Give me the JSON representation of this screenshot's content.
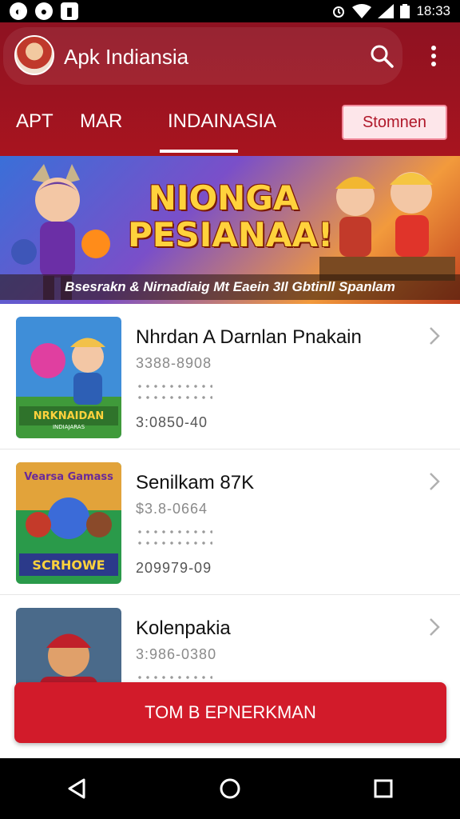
{
  "status_bar": {
    "time": "18:33",
    "left_icons": [
      "notification-icon",
      "record-icon",
      "shield-icon"
    ],
    "right_icons": [
      "alarm-icon",
      "wifi-icon",
      "signal-icon",
      "battery-icon"
    ]
  },
  "header": {
    "app_title": "Apk Indiansia",
    "tabs": [
      {
        "label": "APT"
      },
      {
        "label": "MAR"
      },
      {
        "label": "INDAINASIA"
      }
    ],
    "selected_tab": "INDAINASIA",
    "action_button": "Stomnen"
  },
  "banner": {
    "title_line1": "NIONGA",
    "title_line2": "PESIANAA!",
    "caption": "Bsesrakn & Nirnadiaig Mt Eaein 3Il Gbtinll Spanlam"
  },
  "list": {
    "items": [
      {
        "title": "Nhrdan A Darnlan Pnakain",
        "meta1": "3388-8908",
        "meta2": "3:0850-40",
        "thumb_label": "NRKNAIDAN",
        "thumb_sublabel": "INDIAJARAS"
      },
      {
        "title": "Senilkam 87K",
        "meta1": "$3.8-0664",
        "meta2": "209979-09",
        "thumb_label": "SCRHOWE",
        "thumb_top_label": "Vearsa Gamass"
      },
      {
        "title": "Kolenpakia",
        "meta1": "3:986-0380",
        "meta2": "",
        "thumb_label": ""
      }
    ]
  },
  "cta": {
    "label": "TOM B EPNERKMAN"
  },
  "nav": {
    "icons": [
      "back-icon",
      "home-icon",
      "recents-icon"
    ]
  },
  "colors": {
    "brand": "#a8141f",
    "cta": "#d21b2a",
    "action_bg": "#fde6ea"
  }
}
